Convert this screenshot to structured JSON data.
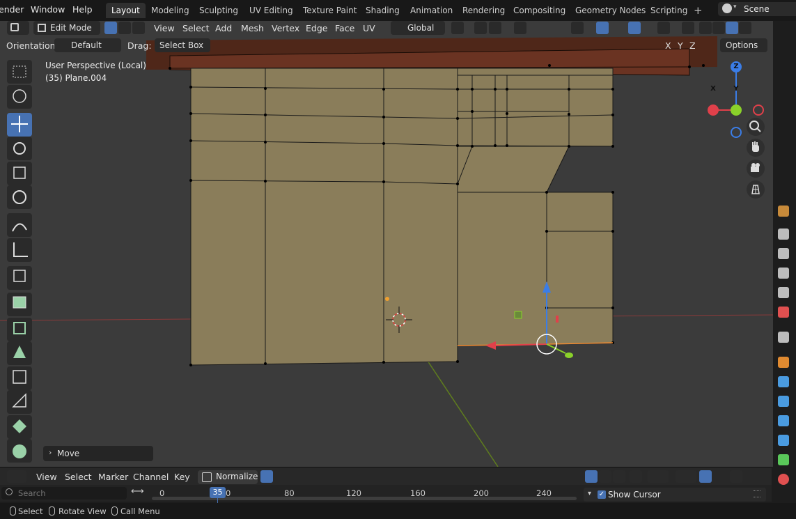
{
  "menubar": {
    "app_menu": "ender",
    "window": "Window",
    "help": "Help"
  },
  "workspaces": [
    {
      "label": "Layout",
      "active": true
    },
    {
      "label": "Modeling"
    },
    {
      "label": "Sculpting"
    },
    {
      "label": "UV Editing"
    },
    {
      "label": "Texture Paint"
    },
    {
      "label": "Shading"
    },
    {
      "label": "Animation"
    },
    {
      "label": "Rendering"
    },
    {
      "label": "Compositing"
    },
    {
      "label": "Geometry Nodes"
    },
    {
      "label": "Scripting"
    }
  ],
  "scene": {
    "label": "Scene"
  },
  "viewport_header": {
    "mode": "Edit Mode",
    "menus": [
      "View",
      "Select",
      "Add",
      "Mesh",
      "Vertex",
      "Edge",
      "Face",
      "UV"
    ],
    "transform_orientation": "Global"
  },
  "tool_settings": {
    "orientation_label": "Orientation:",
    "orientation_value": "Default",
    "drag_label": "Drag:",
    "drag_value": "Select Box",
    "axes": [
      "X",
      "Y",
      "Z"
    ],
    "options": "Options"
  },
  "viewport_info": {
    "view": "User Perspective (Local)",
    "object": "(35) Plane.004"
  },
  "gizmo_axes": {
    "x": "X",
    "y": "Y",
    "z": "Z"
  },
  "last_operator": {
    "label": "Move"
  },
  "timeline": {
    "menus": [
      "View",
      "Select",
      "Marker",
      "Channel",
      "Key"
    ],
    "normalize": "Normalize",
    "search_placeholder": "Search",
    "frame_labels": [
      "0",
      "80",
      "120",
      "160",
      "200",
      "240"
    ],
    "current_frame": "35",
    "current_frame_suffix": "0",
    "show_cursor": "Show Cursor"
  },
  "statusbar": {
    "select": "Select",
    "rotate_view": "Rotate View",
    "call_menu": "Call Menu"
  },
  "colors": {
    "accent": "#4772b3",
    "mesh_face": "#8a7d5a",
    "roof": "#5a2a1c",
    "axis_x": "#e0404a",
    "axis_y": "#8ad12a",
    "axis_z": "#3b7de6"
  }
}
